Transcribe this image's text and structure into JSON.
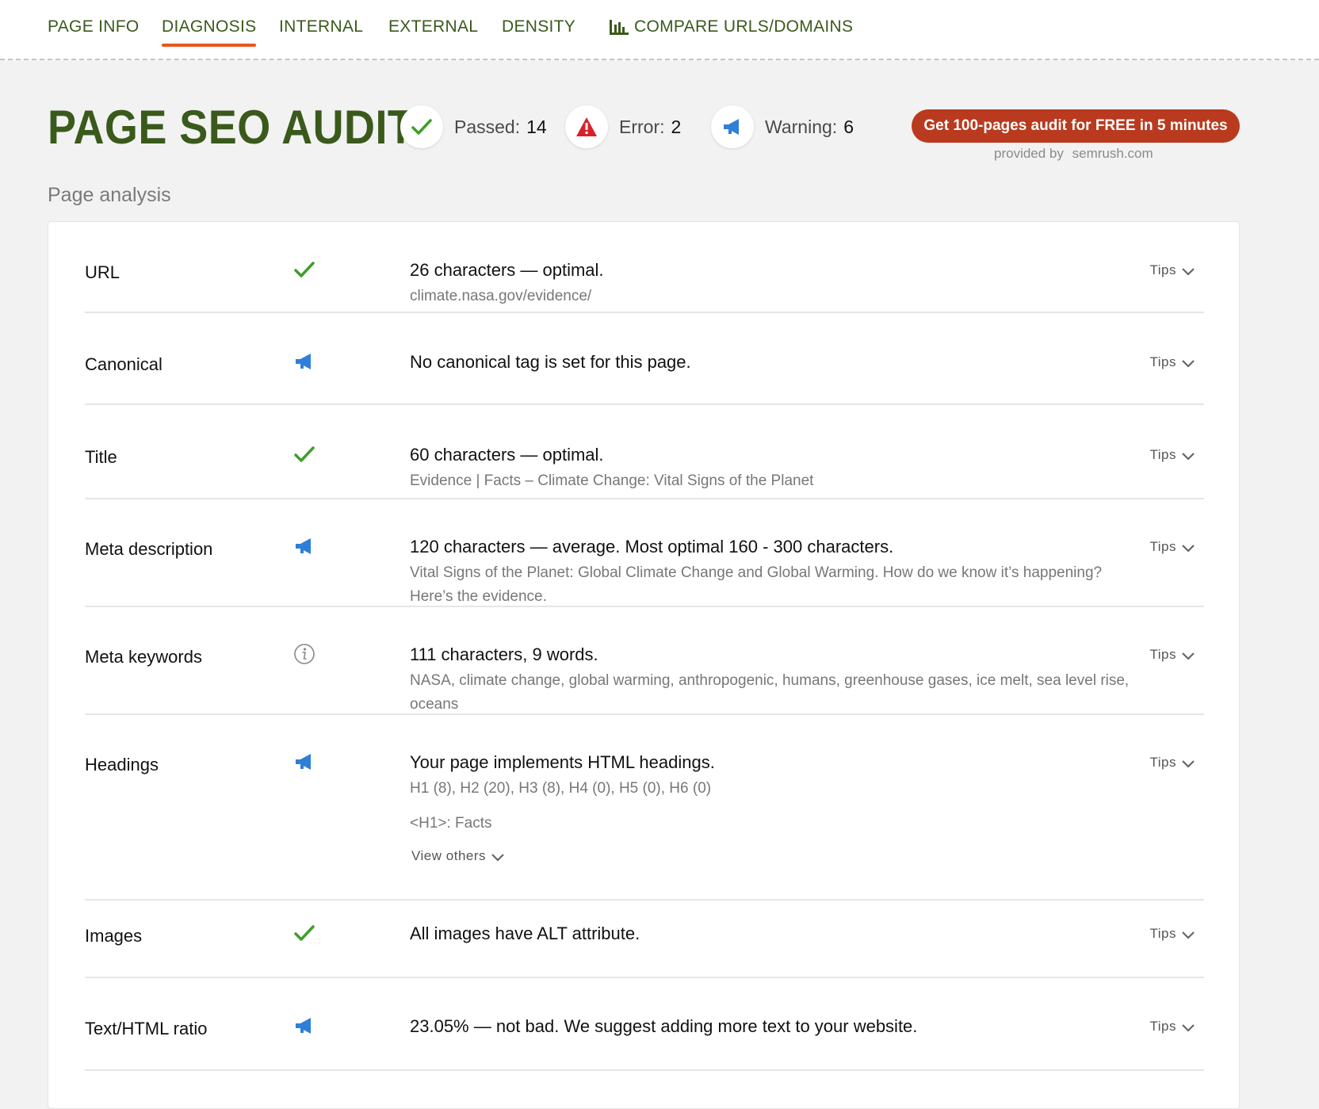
{
  "nav": {
    "tabs": [
      {
        "label": "PAGE INFO"
      },
      {
        "label": "DIAGNOSIS"
      },
      {
        "label": "INTERNAL"
      },
      {
        "label": "EXTERNAL"
      },
      {
        "label": "DENSITY"
      },
      {
        "label": "COMPARE URLS/DOMAINS"
      }
    ],
    "active_tab": "DIAGNOSIS"
  },
  "header": {
    "title": "PAGE SEO AUDIT",
    "passed": {
      "label": "Passed:",
      "count": "14"
    },
    "error": {
      "label": "Error:",
      "count": "2"
    },
    "warning": {
      "label": "Warning:",
      "count": "6"
    },
    "cta": "Get 100-pages audit for FREE in 5 minutes",
    "provided_by": "provided by",
    "provider": "semrush.com"
  },
  "section": {
    "heading": "Page analysis"
  },
  "tips_label": "Tips",
  "rows": [
    {
      "label": "URL",
      "status": "pass",
      "main": "26 characters — optimal.",
      "sub": "climate.nasa.gov/evidence/"
    },
    {
      "label": "Canonical",
      "status": "warning",
      "main": "No canonical tag is set for this page."
    },
    {
      "label": "Title",
      "status": "pass",
      "main": "60 characters — optimal.",
      "sub": "Evidence | Facts – Climate Change: Vital Signs of the Planet"
    },
    {
      "label": "Meta description",
      "status": "warning",
      "main": "120 characters — average. Most optimal 160 - 300 characters.",
      "sub": "Vital Signs of the Planet: Global Climate Change and Global Warming. How do we know it’s happening? Here’s the evidence."
    },
    {
      "label": "Meta keywords",
      "status": "info",
      "main": "111 characters, 9 words.",
      "sub": "NASA, climate change, global warming, anthropogenic, humans, greenhouse gases, ice melt, sea level rise, oceans"
    },
    {
      "label": "Headings",
      "status": "warning",
      "main": "Your page implements HTML headings.",
      "sub": "H1 (8), H2 (20), H3 (8), H4 (0), H5 (0), H6 (0)",
      "h1": "<H1>: Facts",
      "view_others": "View others"
    },
    {
      "label": "Images",
      "status": "pass",
      "main": "All images have ALT attribute."
    },
    {
      "label": "Text/HTML ratio",
      "status": "warning",
      "main": "23.05% — not bad. We suggest adding more text to your website."
    }
  ],
  "colors": {
    "brand_green": "#3a5a1c",
    "active_underline": "#e8561c",
    "cta_bg": "#b93a1e",
    "pass": "#3f9e2a",
    "error": "#d6222a",
    "warning": "#2f7fd8"
  },
  "icons": {
    "pass": "check-icon",
    "error": "alert-triangle-icon",
    "warning": "megaphone-icon",
    "info": "info-icon",
    "compare": "bar-chart-icon",
    "expand": "chevron-down-icon"
  }
}
